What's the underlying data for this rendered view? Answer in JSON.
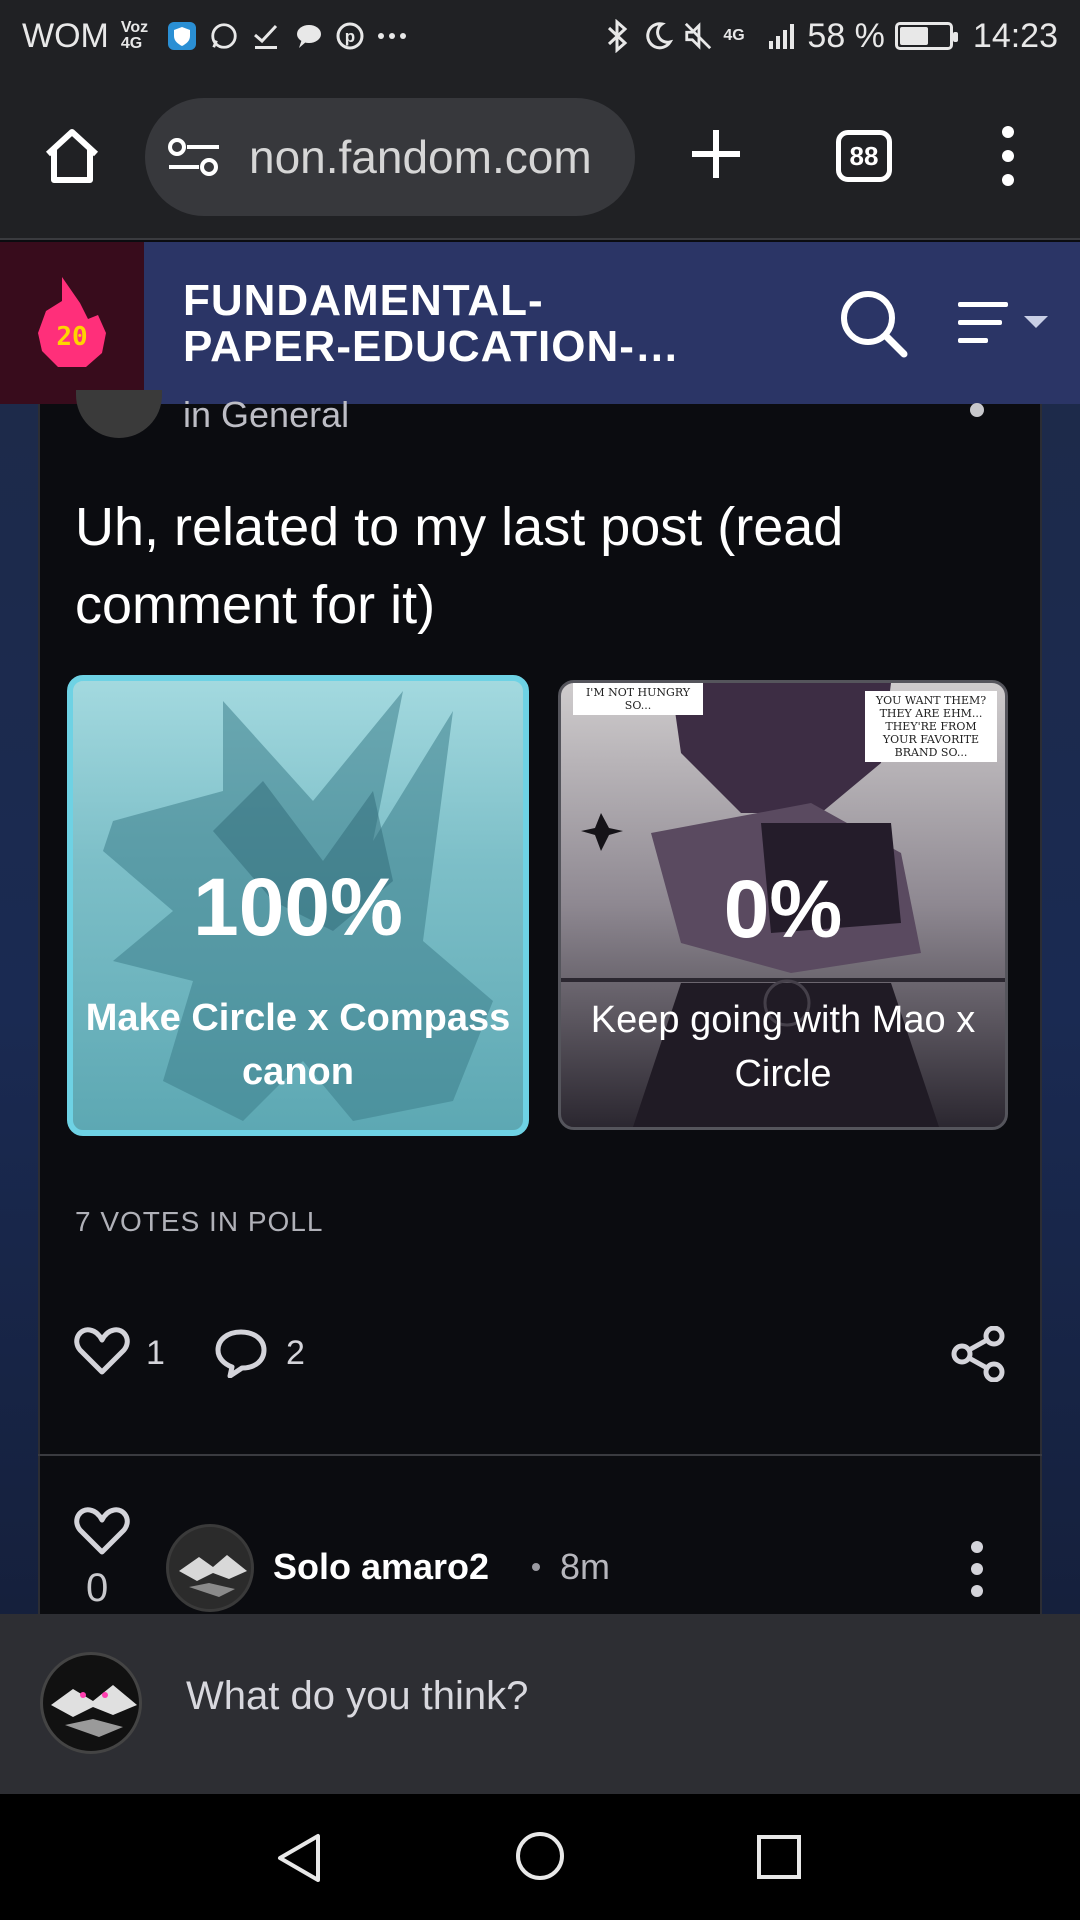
{
  "status_bar": {
    "carrier": "WOM",
    "net_small": "Voz 4G",
    "bluetooth_icon": "bluetooth-icon",
    "signal_label": "4G",
    "battery": "58 %",
    "battery_level": 0.58,
    "time": "14:23"
  },
  "browser": {
    "url": "non.fandom.com",
    "tab_count": "88"
  },
  "site": {
    "badge_number": "20",
    "title_line1": "FUNDAMENTAL-",
    "title_line2": "PAPER-EDUCATION-…",
    "accent": "#2b3566"
  },
  "post": {
    "category": "in General",
    "title": "Uh, related to my last post (read comment for it)",
    "poll": {
      "options": [
        {
          "percent": "100%",
          "label": "Make Circle x Compass canon",
          "selected": true
        },
        {
          "percent": "0%",
          "label": "Keep going with Mao x Circle",
          "selected": false
        }
      ],
      "option2_bubble_left": "I'M NOT HUNGRY SO...",
      "option2_bubble_right": "YOU WANT THEM? THEY ARE EHM... THEY'RE FROM YOUR FAVORITE BRAND SO...",
      "votes": "7 VOTES IN POLL"
    },
    "likes": "1",
    "comments": "2"
  },
  "reply": {
    "likes": "0",
    "username": "Solo amaro2",
    "time": "8m"
  },
  "comment_input": {
    "placeholder": "What do you think?"
  },
  "colors": {
    "selected_option_border": "#6ed2e4",
    "header_bg": "#2b3566",
    "card_bg": "#0b0c10"
  }
}
